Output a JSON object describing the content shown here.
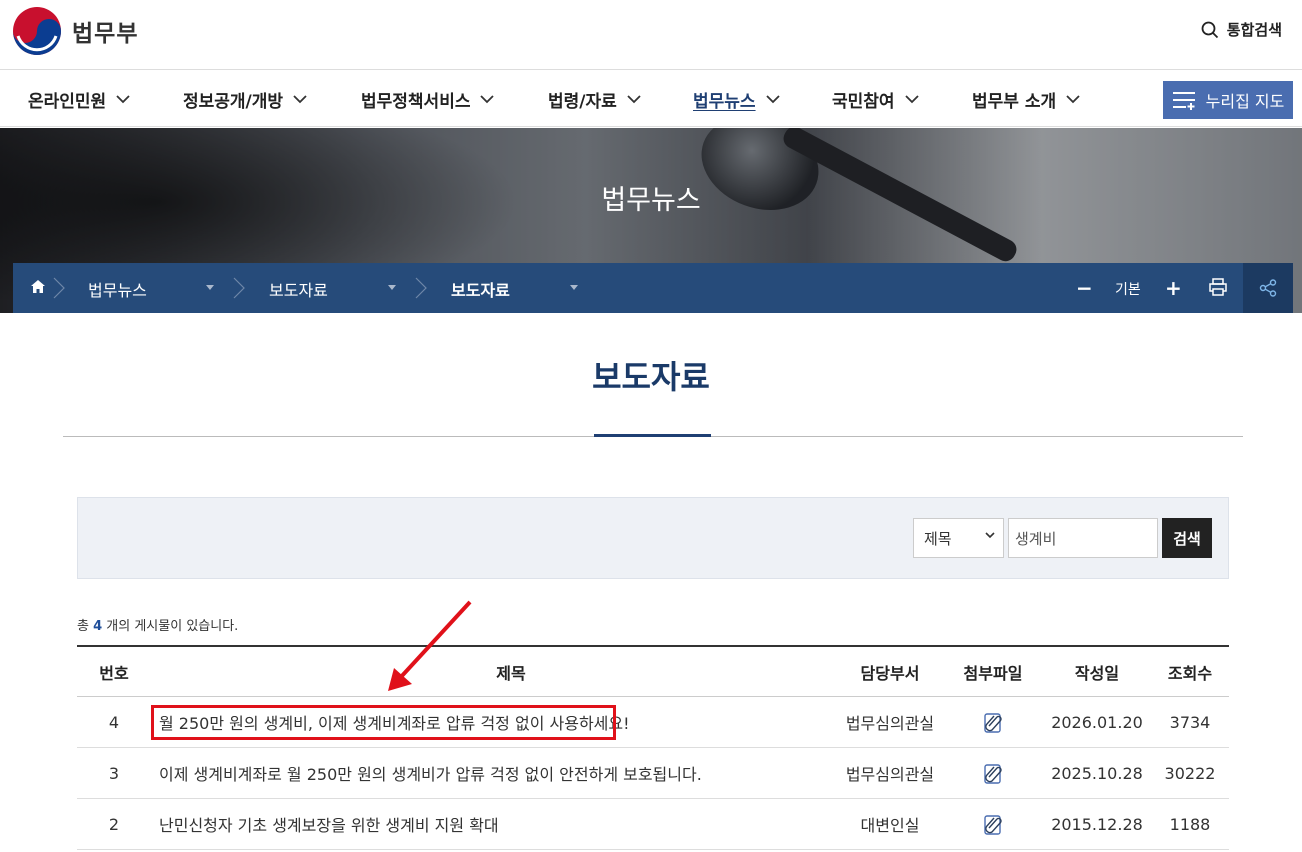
{
  "header": {
    "logo_text": "법무부",
    "search_label": "통합검색"
  },
  "gnb": {
    "items": [
      {
        "label": "온라인민원"
      },
      {
        "label": "정보공개/개방"
      },
      {
        "label": "법무정책서비스"
      },
      {
        "label": "법령/자료"
      },
      {
        "label": "법무뉴스"
      },
      {
        "label": "국민참여"
      },
      {
        "label": "법무부 소개"
      }
    ],
    "active": "법무뉴스",
    "sitemap_label": "누리집 지도"
  },
  "visual": {
    "title": "법무뉴스"
  },
  "location": {
    "items": [
      "법무뉴스",
      "보도자료",
      "보도자료"
    ],
    "zoom_minus": "−",
    "zoom_label": "기본",
    "zoom_plus": "+"
  },
  "page": {
    "title": "보도자료"
  },
  "search": {
    "select_value": "제목",
    "keyword": "생계비",
    "button_label": "검색"
  },
  "summary": {
    "prefix": "총",
    "count": "4",
    "suffix": "개의 게시물이 있습니다."
  },
  "table": {
    "headers": {
      "no": "번호",
      "title": "제목",
      "dept": "담당부서",
      "file": "첨부파일",
      "date": "작성일",
      "views": "조회수"
    },
    "rows": [
      {
        "no": "4",
        "title": "월 250만 원의 생계비, 이제 생계비계좌로 압류 걱정 없이 사용하세요!",
        "dept": "법무심의관실",
        "date": "2026.01.20",
        "views": "3734"
      },
      {
        "no": "3",
        "title": "이제 생계비계좌로 월 250만 원의 생계비가 압류 걱정 없이 안전하게 보호됩니다.",
        "dept": "법무심의관실",
        "date": "2025.10.28",
        "views": "30222"
      },
      {
        "no": "2",
        "title": "난민신청자 기초 생계보장을 위한 생계비 지원 확대",
        "dept": "대변인실",
        "date": "2015.12.28",
        "views": "1188"
      }
    ]
  },
  "colors": {
    "brand_navy": "#264b7a",
    "title_navy": "#1a3a68",
    "sitemap_blue": "#4a6db0",
    "annotation_red": "#e0111a"
  }
}
